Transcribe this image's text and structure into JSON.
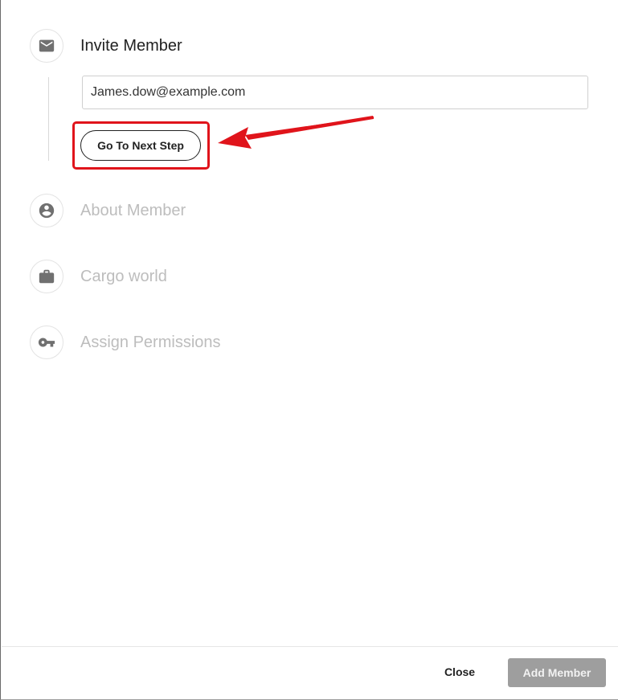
{
  "steps": [
    {
      "label": "Invite Member",
      "icon": "envelope-icon",
      "active": true
    },
    {
      "label": "About Member",
      "icon": "account-circle-icon",
      "active": false
    },
    {
      "label": "Cargo world",
      "icon": "briefcase-icon",
      "active": false
    },
    {
      "label": "Assign Permissions",
      "icon": "key-icon",
      "active": false
    }
  ],
  "invite": {
    "email_value": "James.dow@example.com",
    "next_button_label": "Go To Next Step"
  },
  "footer": {
    "close_label": "Close",
    "add_label": "Add Member"
  },
  "colors": {
    "highlight": "#e0141b",
    "inactive_text": "#bdbdbd",
    "add_button_bg": "#9e9e9e"
  }
}
